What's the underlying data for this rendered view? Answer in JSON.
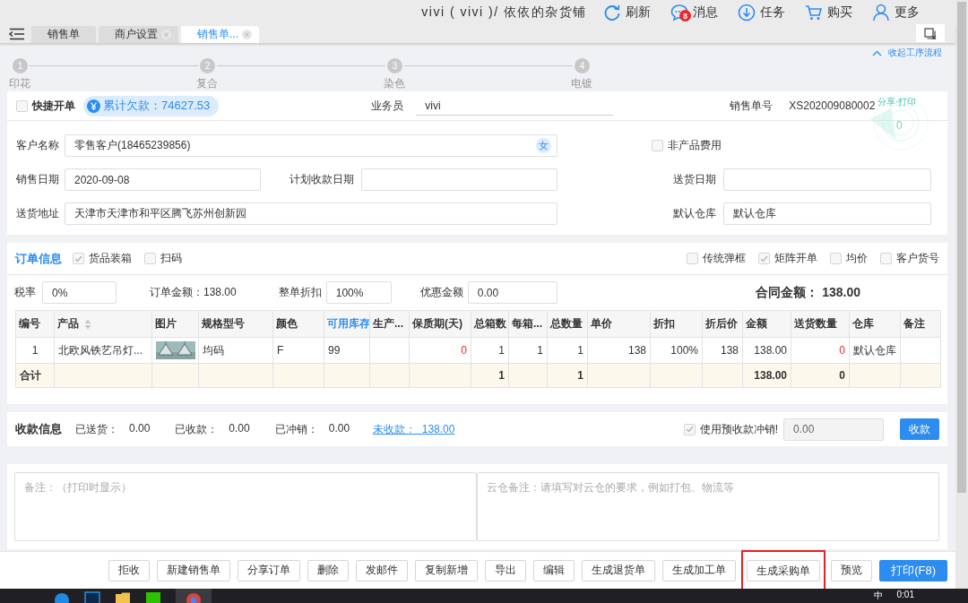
{
  "header": {
    "account": "vivi ( vivi )/ 依依的杂货铺",
    "actions": [
      {
        "kind": "refresh",
        "label": "刷新"
      },
      {
        "kind": "message",
        "label": "消息",
        "badge": "8"
      },
      {
        "kind": "task",
        "label": "任务"
      },
      {
        "kind": "cart",
        "label": "购买"
      },
      {
        "kind": "user",
        "label": "更多"
      }
    ]
  },
  "tabs": [
    {
      "label": "销售单",
      "selected": false,
      "closable": false
    },
    {
      "label": "商户设置",
      "selected": false,
      "closable": true
    },
    {
      "label": "销售单...",
      "selected": true,
      "closable": true
    }
  ],
  "process": {
    "collapse_link": "收起工序流程",
    "steps": [
      {
        "number": "1",
        "label": "印花"
      },
      {
        "number": "2",
        "label": "复合"
      },
      {
        "number": "3",
        "label": "染色"
      },
      {
        "number": "4",
        "label": "电镀"
      }
    ]
  },
  "order_header": {
    "quick_order": {
      "label": "快捷开单",
      "checked": false
    },
    "debt_badge": "累计欠款：74627.53",
    "salesperson": {
      "label": "业务员",
      "value": "vivi"
    },
    "order_number": {
      "label": "销售单号",
      "value": "XS202009080002"
    },
    "stamp": {
      "caption": "分享·打印",
      "count": "0"
    },
    "customer": {
      "label": "客户名称",
      "value": "零售客户(18465239856)",
      "gender": "女"
    },
    "non_product_fee": {
      "label": "非产品费用",
      "checked": false
    },
    "fields": [
      {
        "label": "销售日期",
        "value": "2020-09-08"
      },
      {
        "label": "计划收款日期"
      },
      {
        "label": "送货日期"
      },
      {
        "label": "送货地址",
        "value": "天津市天津市和平区腾飞苏州创新园"
      },
      {
        "label": "默认仓库",
        "value": "默认仓库"
      }
    ]
  },
  "order_info": {
    "title": "订单信息",
    "options_left": [
      {
        "label": "货品装箱",
        "checked": true
      },
      {
        "label": "扫码",
        "checked": false
      }
    ],
    "options_right": [
      {
        "label": "传统弹框",
        "checked": false
      },
      {
        "label": "矩阵开单",
        "checked": true
      },
      {
        "label": "均价",
        "checked": false
      },
      {
        "label": "客户货号",
        "checked": false
      }
    ],
    "tax": {
      "label": "税率",
      "value": "0%"
    },
    "order_amount": "订单金额：138.00",
    "discount": {
      "label": "整单折扣",
      "value": "100%"
    },
    "coupon": {
      "label": "优惠金额",
      "value": "0.00"
    },
    "contract_total": {
      "label": "合同金额：",
      "value": "138.00"
    },
    "table": {
      "columns": [
        {
          "label": "编号",
          "kind": "plain"
        },
        {
          "label": "产品",
          "kind": "sortable"
        },
        {
          "label": "图片",
          "kind": "plain"
        },
        {
          "label": "规格型号",
          "kind": "plain"
        },
        {
          "label": "颜色",
          "kind": "plain"
        },
        {
          "label": "可用库存",
          "kind": "highlighted"
        },
        {
          "label": "生产...",
          "kind": "plain"
        },
        {
          "label": "保质期(天)",
          "kind": "plain"
        },
        {
          "label": "总箱数",
          "kind": "plain"
        },
        {
          "label": "每箱...",
          "kind": "plain"
        },
        {
          "label": "总数量",
          "kind": "plain"
        },
        {
          "label": "单价",
          "kind": "plain"
        },
        {
          "label": "折扣",
          "kind": "plain"
        },
        {
          "label": "折后价",
          "kind": "plain"
        },
        {
          "label": "金额",
          "kind": "plain"
        },
        {
          "label": "送货数量",
          "kind": "plain"
        },
        {
          "label": "仓库",
          "kind": "plain"
        },
        {
          "label": "备注",
          "kind": "plain"
        }
      ],
      "rows": [
        {
          "cells": [
            "1",
            "北欧风铁艺吊灯...",
            {
              "kind": "picture"
            },
            "均码",
            "F",
            "99",
            {
              "kind": "empty"
            },
            {
              "text": "0",
              "warning": true
            },
            "1",
            "1",
            "1",
            "138",
            "100%",
            "138",
            "138.00",
            {
              "text": "0",
              "warning": true
            },
            "默认仓库",
            {
              "kind": "empty"
            }
          ]
        }
      ],
      "total": [
        "合计",
        {
          "kind": "empty"
        },
        {
          "kind": "empty"
        },
        {
          "kind": "empty"
        },
        {
          "kind": "empty"
        },
        {
          "kind": "empty"
        },
        {
          "kind": "empty"
        },
        {
          "kind": "empty"
        },
        "1",
        {
          "kind": "empty"
        },
        "1",
        {
          "kind": "empty"
        },
        {
          "kind": "empty"
        },
        {
          "kind": "empty"
        },
        "138.00",
        "0",
        {
          "kind": "empty"
        },
        {
          "kind": "empty"
        }
      ]
    }
  },
  "payment": {
    "title": "收款信息",
    "items": [
      {
        "label": "已送货：",
        "value": "0.00"
      },
      {
        "label": "已收款：",
        "value": "0.00"
      },
      {
        "label": "已冲销：",
        "value": "0.00"
      }
    ],
    "unpaid_link": "未收款：  138.00",
    "offset": {
      "label": "使用预收款冲销!",
      "checked": true
    },
    "offset_value": "0.00",
    "button": "收款"
  },
  "notes": {
    "remark_placeholder": "备注：（打印时显示）",
    "cloud_placeholder": "云仓备注：请填写对云仓的要求，例如打包、物流等"
  },
  "actions": [
    {
      "label": "拒收",
      "kind": "default",
      "highlighted": false
    },
    {
      "label": "新建销售单",
      "kind": "default",
      "highlighted": false
    },
    {
      "label": "分享订单",
      "kind": "default",
      "highlighted": false
    },
    {
      "label": "删除",
      "kind": "default",
      "highlighted": false
    },
    {
      "label": "发邮件",
      "kind": "default",
      "highlighted": false
    },
    {
      "label": "复制新增",
      "kind": "default",
      "highlighted": false
    },
    {
      "label": "导出",
      "kind": "default",
      "highlighted": false
    },
    {
      "label": "编辑",
      "kind": "default",
      "highlighted": false
    },
    {
      "label": "生成退货单",
      "kind": "default",
      "highlighted": false
    },
    {
      "label": "生成加工单",
      "kind": "default",
      "highlighted": false
    },
    {
      "label": "生成采购单",
      "kind": "default",
      "highlighted": true
    },
    {
      "label": "预览",
      "kind": "default",
      "highlighted": false
    },
    {
      "label": "打印(F8)",
      "kind": "primary",
      "highlighted": false
    }
  ],
  "taskbar": {
    "ime": "中",
    "time": "0:01"
  }
}
